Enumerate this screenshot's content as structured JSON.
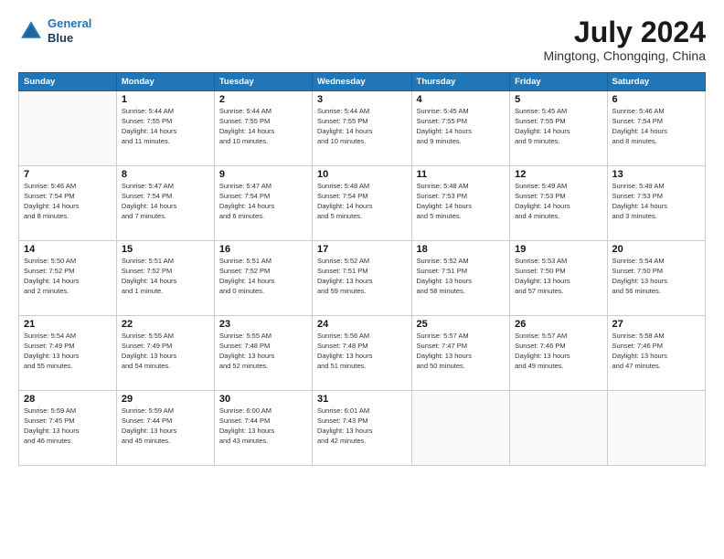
{
  "header": {
    "logo_line1": "General",
    "logo_line2": "Blue",
    "main_title": "July 2024",
    "sub_title": "Mingtong, Chongqing, China"
  },
  "weekdays": [
    "Sunday",
    "Monday",
    "Tuesday",
    "Wednesday",
    "Thursday",
    "Friday",
    "Saturday"
  ],
  "weeks": [
    [
      {
        "day": "",
        "info": ""
      },
      {
        "day": "1",
        "info": "Sunrise: 5:44 AM\nSunset: 7:55 PM\nDaylight: 14 hours\nand 11 minutes."
      },
      {
        "day": "2",
        "info": "Sunrise: 5:44 AM\nSunset: 7:55 PM\nDaylight: 14 hours\nand 10 minutes."
      },
      {
        "day": "3",
        "info": "Sunrise: 5:44 AM\nSunset: 7:55 PM\nDaylight: 14 hours\nand 10 minutes."
      },
      {
        "day": "4",
        "info": "Sunrise: 5:45 AM\nSunset: 7:55 PM\nDaylight: 14 hours\nand 9 minutes."
      },
      {
        "day": "5",
        "info": "Sunrise: 5:45 AM\nSunset: 7:55 PM\nDaylight: 14 hours\nand 9 minutes."
      },
      {
        "day": "6",
        "info": "Sunrise: 5:46 AM\nSunset: 7:54 PM\nDaylight: 14 hours\nand 8 minutes."
      }
    ],
    [
      {
        "day": "7",
        "info": "Sunrise: 5:46 AM\nSunset: 7:54 PM\nDaylight: 14 hours\nand 8 minutes."
      },
      {
        "day": "8",
        "info": "Sunrise: 5:47 AM\nSunset: 7:54 PM\nDaylight: 14 hours\nand 7 minutes."
      },
      {
        "day": "9",
        "info": "Sunrise: 5:47 AM\nSunset: 7:54 PM\nDaylight: 14 hours\nand 6 minutes."
      },
      {
        "day": "10",
        "info": "Sunrise: 5:48 AM\nSunset: 7:54 PM\nDaylight: 14 hours\nand 5 minutes."
      },
      {
        "day": "11",
        "info": "Sunrise: 5:48 AM\nSunset: 7:53 PM\nDaylight: 14 hours\nand 5 minutes."
      },
      {
        "day": "12",
        "info": "Sunrise: 5:49 AM\nSunset: 7:53 PM\nDaylight: 14 hours\nand 4 minutes."
      },
      {
        "day": "13",
        "info": "Sunrise: 5:49 AM\nSunset: 7:53 PM\nDaylight: 14 hours\nand 3 minutes."
      }
    ],
    [
      {
        "day": "14",
        "info": "Sunrise: 5:50 AM\nSunset: 7:52 PM\nDaylight: 14 hours\nand 2 minutes."
      },
      {
        "day": "15",
        "info": "Sunrise: 5:51 AM\nSunset: 7:52 PM\nDaylight: 14 hours\nand 1 minute."
      },
      {
        "day": "16",
        "info": "Sunrise: 5:51 AM\nSunset: 7:52 PM\nDaylight: 14 hours\nand 0 minutes."
      },
      {
        "day": "17",
        "info": "Sunrise: 5:52 AM\nSunset: 7:51 PM\nDaylight: 13 hours\nand 59 minutes."
      },
      {
        "day": "18",
        "info": "Sunrise: 5:52 AM\nSunset: 7:51 PM\nDaylight: 13 hours\nand 58 minutes."
      },
      {
        "day": "19",
        "info": "Sunrise: 5:53 AM\nSunset: 7:50 PM\nDaylight: 13 hours\nand 57 minutes."
      },
      {
        "day": "20",
        "info": "Sunrise: 5:54 AM\nSunset: 7:50 PM\nDaylight: 13 hours\nand 56 minutes."
      }
    ],
    [
      {
        "day": "21",
        "info": "Sunrise: 5:54 AM\nSunset: 7:49 PM\nDaylight: 13 hours\nand 55 minutes."
      },
      {
        "day": "22",
        "info": "Sunrise: 5:55 AM\nSunset: 7:49 PM\nDaylight: 13 hours\nand 54 minutes."
      },
      {
        "day": "23",
        "info": "Sunrise: 5:55 AM\nSunset: 7:48 PM\nDaylight: 13 hours\nand 52 minutes."
      },
      {
        "day": "24",
        "info": "Sunrise: 5:56 AM\nSunset: 7:48 PM\nDaylight: 13 hours\nand 51 minutes."
      },
      {
        "day": "25",
        "info": "Sunrise: 5:57 AM\nSunset: 7:47 PM\nDaylight: 13 hours\nand 50 minutes."
      },
      {
        "day": "26",
        "info": "Sunrise: 5:57 AM\nSunset: 7:46 PM\nDaylight: 13 hours\nand 49 minutes."
      },
      {
        "day": "27",
        "info": "Sunrise: 5:58 AM\nSunset: 7:46 PM\nDaylight: 13 hours\nand 47 minutes."
      }
    ],
    [
      {
        "day": "28",
        "info": "Sunrise: 5:59 AM\nSunset: 7:45 PM\nDaylight: 13 hours\nand 46 minutes."
      },
      {
        "day": "29",
        "info": "Sunrise: 5:59 AM\nSunset: 7:44 PM\nDaylight: 13 hours\nand 45 minutes."
      },
      {
        "day": "30",
        "info": "Sunrise: 6:00 AM\nSunset: 7:44 PM\nDaylight: 13 hours\nand 43 minutes."
      },
      {
        "day": "31",
        "info": "Sunrise: 6:01 AM\nSunset: 7:43 PM\nDaylight: 13 hours\nand 42 minutes."
      },
      {
        "day": "",
        "info": ""
      },
      {
        "day": "",
        "info": ""
      },
      {
        "day": "",
        "info": ""
      }
    ]
  ]
}
